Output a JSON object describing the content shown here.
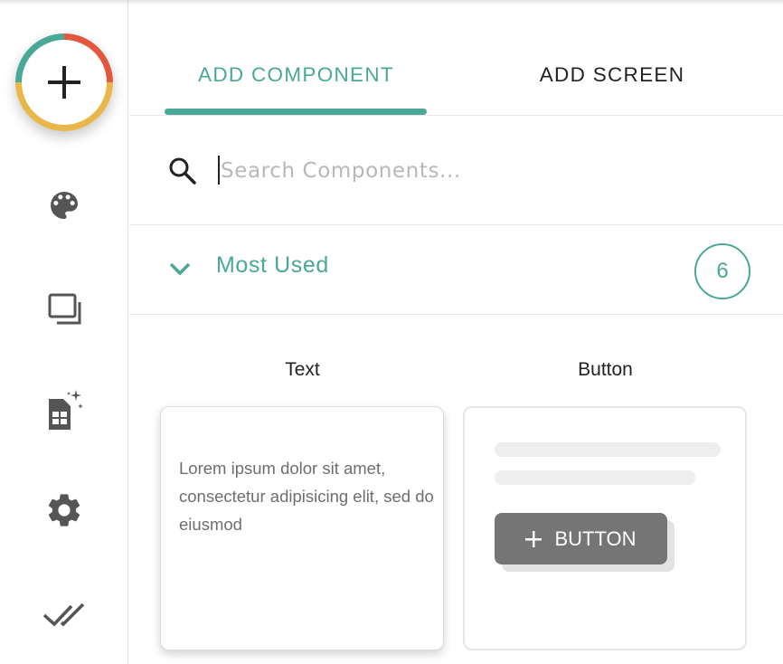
{
  "sidebar": {
    "add_button_icon": "plus-icon",
    "items": [
      {
        "icon": "palette-icon",
        "label": ""
      },
      {
        "icon": "screens-icon",
        "label": ""
      },
      {
        "icon": "data-sheet-magic-icon",
        "label": ""
      },
      {
        "icon": "gear-icon",
        "label": ""
      },
      {
        "icon": "double-check-icon",
        "label": ""
      }
    ],
    "colors": {
      "ring_red": "#e2583e",
      "ring_yellow": "#e9b64a",
      "ring_teal": "#4aa896"
    }
  },
  "tabs": [
    {
      "label": "ADD COMPONENT",
      "active": true
    },
    {
      "label": "ADD SCREEN",
      "active": false
    }
  ],
  "search": {
    "placeholder": "Search Components...",
    "value": ""
  },
  "section": {
    "title": "Most Used",
    "count": "6",
    "expanded": true
  },
  "components": [
    {
      "label": "Text",
      "preview_text": "Lorem ipsum dolor sit amet, consectetur adipisicing elit, sed do eiusmod"
    },
    {
      "label": "Button",
      "preview_button_label": "BUTTON"
    }
  ],
  "accent_color": "#4aa896"
}
